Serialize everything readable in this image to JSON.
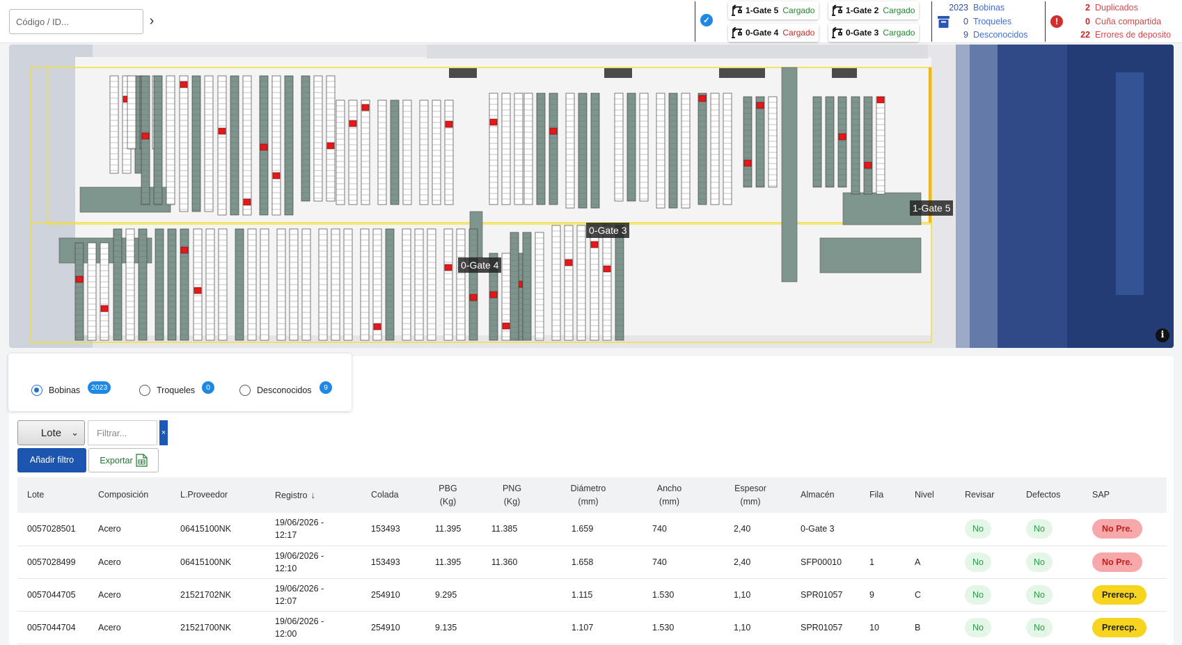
{
  "search": {
    "placeholder": "Código / ID...",
    "go": "›"
  },
  "gates": [
    {
      "name": "1-Gate 5",
      "status": "Cargado",
      "status_color": "green"
    },
    {
      "name": "1-Gate 2",
      "status": "Cargado",
      "status_color": "green"
    },
    {
      "name": "0-Gate 4",
      "status": "Cargado",
      "status_color": "red"
    },
    {
      "name": "0-Gate 3",
      "status": "Cargado",
      "status_color": "green"
    }
  ],
  "inventory": [
    {
      "num": "2023",
      "label": "Bobinas"
    },
    {
      "num": "0",
      "label": "Troqueles"
    },
    {
      "num": "9",
      "label": "Desconocidos"
    }
  ],
  "errors": [
    {
      "num": "2",
      "label": "Duplicados"
    },
    {
      "num": "0",
      "label": "Cuña compartida"
    },
    {
      "num": "22",
      "label": "Errores de deposito"
    }
  ],
  "map": {
    "gate_labels": [
      "1-Gate 5",
      "0-Gate 3",
      "0-Gate 4"
    ],
    "info": "i"
  },
  "type_filter": {
    "options": [
      {
        "label": "Bobinas",
        "count": "2023",
        "checked": true
      },
      {
        "label": "Troqueles",
        "count": "0",
        "checked": false
      },
      {
        "label": "Desconocidos",
        "count": "9",
        "checked": false
      }
    ]
  },
  "filters": {
    "field_select": "Lote",
    "filter_placeholder": "Filtrar...",
    "clear": "×",
    "add_filter": "Añadir filtro",
    "export": "Exportar"
  },
  "table": {
    "columns": [
      [
        "Lote"
      ],
      [
        "Composición"
      ],
      [
        "L.Proveedor"
      ],
      [
        "Registro"
      ],
      [
        "Colada"
      ],
      [
        "PBG",
        "(Kg)"
      ],
      [
        "PNG",
        "(Kg)"
      ],
      [
        "Diámetro",
        "(mm)"
      ],
      [
        "Ancho",
        "(mm)"
      ],
      [
        "Espesor",
        "(mm)"
      ],
      [
        "Almacén"
      ],
      [
        "Fila"
      ],
      [
        "Nivel"
      ],
      [
        "Revisar"
      ],
      [
        "Defectos"
      ],
      [
        "SAP"
      ]
    ],
    "sort_indicator": "↓",
    "rows": [
      {
        "lote": "0057028501",
        "comp": "Acero",
        "prov": "06415100NK",
        "reg1": "19/06/2026 -",
        "reg2": "12:17",
        "colada": "153493",
        "pbg": "11.395",
        "png": "11.385",
        "diam": "1.659",
        "ancho": "740",
        "esp": "2,40",
        "alm": "0-Gate 3",
        "fila": "",
        "nivel": "",
        "revisar": "No",
        "defectos": "No",
        "sap": "No Pre.",
        "sap_type": "nopre"
      },
      {
        "lote": "0057028499",
        "comp": "Acero",
        "prov": "06415100NK",
        "reg1": "19/06/2026 -",
        "reg2": "12:10",
        "colada": "153493",
        "pbg": "11.395",
        "png": "11.360",
        "diam": "1.658",
        "ancho": "740",
        "esp": "2,40",
        "alm": "SFP00010",
        "fila": "1",
        "nivel": "A",
        "revisar": "No",
        "defectos": "No",
        "sap": "No Pre.",
        "sap_type": "nopre"
      },
      {
        "lote": "0057044705",
        "comp": "Acero",
        "prov": "21521702NK",
        "reg1": "19/06/2026 -",
        "reg2": "12:07",
        "colada": "254910",
        "pbg": "9.295",
        "png": "",
        "diam": "1.115",
        "ancho": "1.530",
        "esp": "1,10",
        "alm": "SPR01057",
        "fila": "9",
        "nivel": "C",
        "revisar": "No",
        "defectos": "No",
        "sap": "Prerecp.",
        "sap_type": "prerecp"
      },
      {
        "lote": "0057044704",
        "comp": "Acero",
        "prov": "21521700NK",
        "reg1": "19/06/2026 -",
        "reg2": "12:00",
        "colada": "254910",
        "pbg": "9.135",
        "png": "",
        "diam": "1.107",
        "ancho": "1.530",
        "esp": "1,10",
        "alm": "SPR01057",
        "fila": "10",
        "nivel": "B",
        "revisar": "No",
        "defectos": "No",
        "sap": "Prerecp.",
        "sap_type": "prerecp"
      }
    ]
  }
}
